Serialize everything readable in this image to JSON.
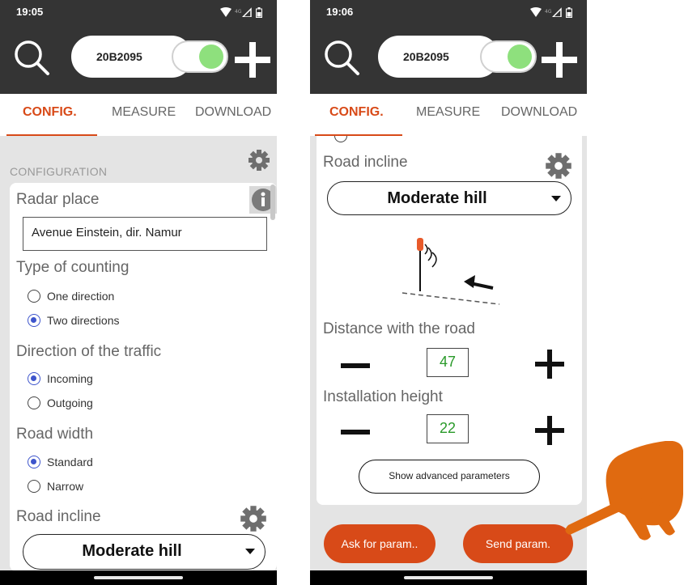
{
  "phone1": {
    "status_time": "19:05",
    "device_id": "20B2095",
    "tabs": [
      "CONFIG.",
      "MEASURE",
      "DOWNLOAD"
    ],
    "section_title": "CONFIGURATION",
    "radar_place_label": "Radar place",
    "radar_place_value": "Avenue Einstein, dir. Namur",
    "counting_label": "Type of counting",
    "counting_options": [
      "One direction",
      "Two directions"
    ],
    "counting_selected": "Two directions",
    "traffic_label": "Direction of the traffic",
    "traffic_options": [
      "Incoming",
      "Outgoing"
    ],
    "traffic_selected": "Incoming",
    "width_label": "Road width",
    "width_options": [
      "Standard",
      "Narrow"
    ],
    "width_selected": "Standard",
    "incline_label": "Road incline",
    "incline_value": "Moderate hill"
  },
  "phone2": {
    "status_time": "19:06",
    "device_id": "20B2095",
    "tabs": [
      "CONFIG.",
      "MEASURE",
      "DOWNLOAD"
    ],
    "incline_label": "Road incline",
    "incline_value": "Moderate hill",
    "distance_label": "Distance with the road",
    "distance_value": "47",
    "height_label": "Installation height",
    "height_value": "22",
    "advanced_button": "Show advanced parameters",
    "ask_button": "Ask for param..",
    "send_button": "Send param."
  },
  "colors": {
    "accent": "#d84a18",
    "app_bar": "#343434",
    "toggle_on": "#8ee07d",
    "radio_selected": "#3e55cc",
    "number_text": "#2a9a2a",
    "hand": "#e06a10"
  }
}
